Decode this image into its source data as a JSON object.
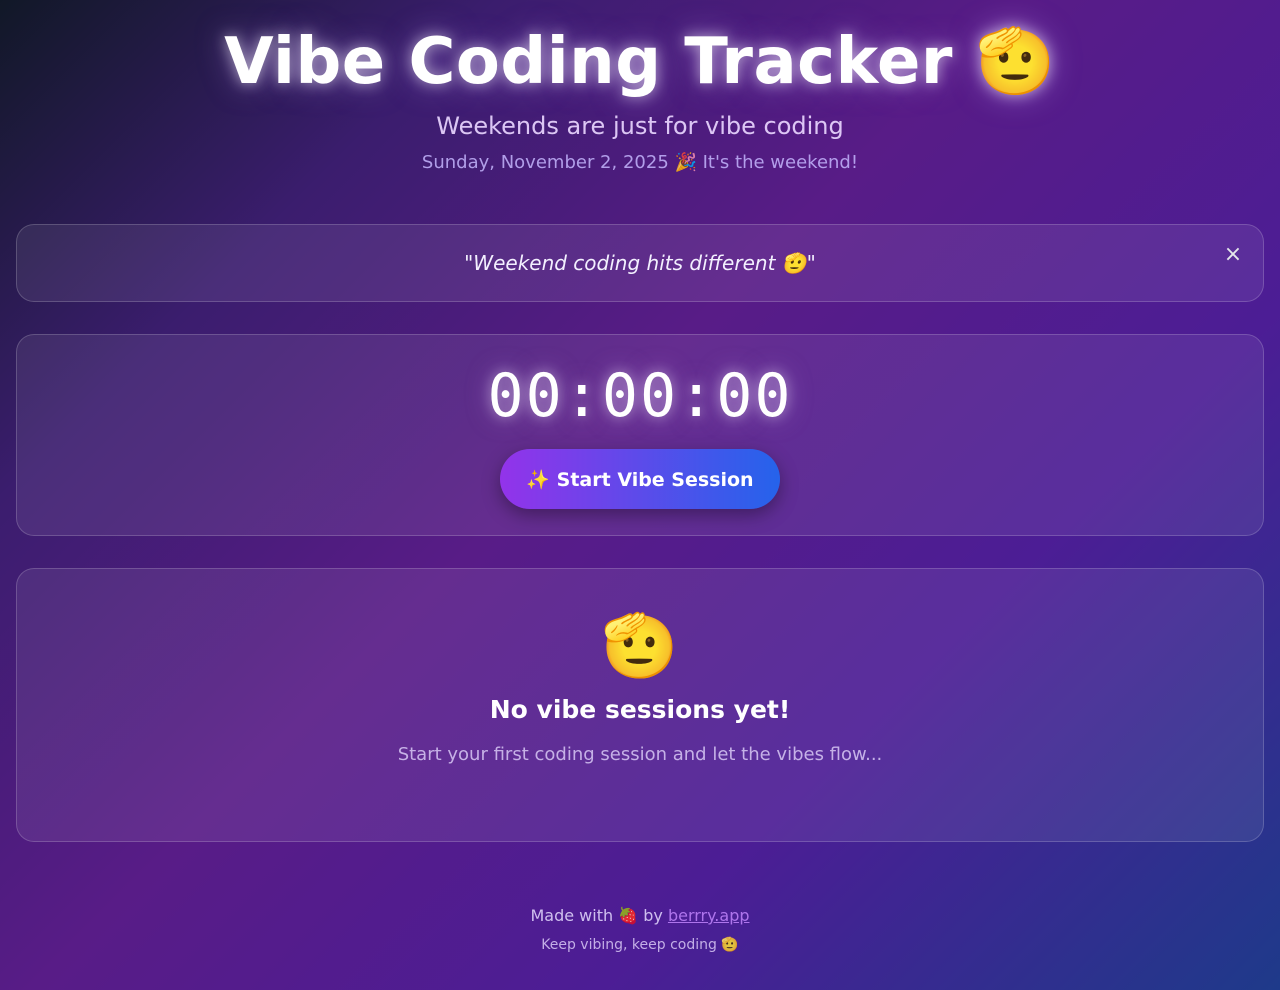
{
  "header": {
    "title": "Vibe Coding Tracker 🫡",
    "subtitle": "Weekends are just for vibe coding",
    "date_line": "Sunday, November 2, 2025 🎉 It's the weekend!"
  },
  "quote": {
    "text": "\"Weekend coding hits different 🫡\"",
    "close_label": "×"
  },
  "timer": {
    "value": "00:00:00",
    "start_button_label": "✨ Start Vibe Session"
  },
  "sessions": {
    "empty_emoji": "🫡",
    "empty_title": "No vibe sessions yet!",
    "empty_subtitle": "Start your first coding session and let the vibes flow..."
  },
  "footer": {
    "made_with_prefix": "Made with 🍓 by ",
    "link_text": "berrry.app",
    "tagline": "Keep vibing, keep coding 🫡"
  },
  "colors": {
    "button_gradient_start": "#9333ea",
    "button_gradient_end": "#2563eb",
    "link": "#c084fc"
  }
}
